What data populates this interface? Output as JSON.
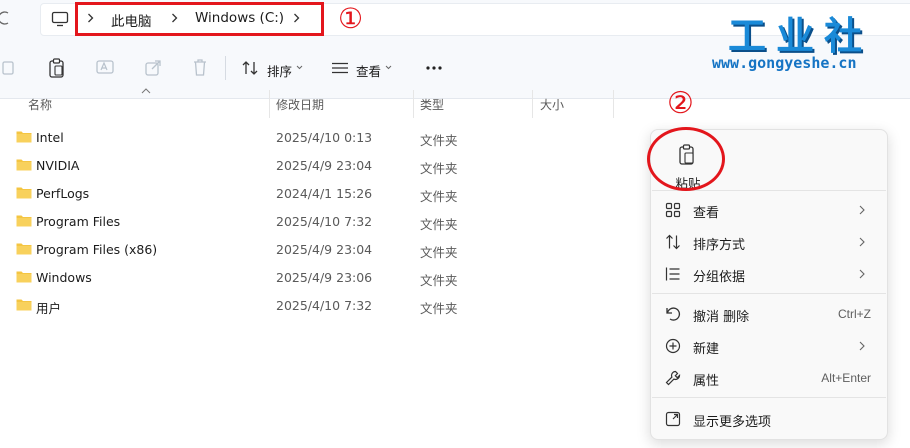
{
  "address_bar": {
    "crumbs": [
      "此电脑",
      "Windows (C:)"
    ]
  },
  "annotations": {
    "marker1": "①",
    "marker2": "②"
  },
  "toolbar": {
    "sort_label": "排序",
    "view_label": "查看"
  },
  "columns": {
    "name": "名称",
    "date": "修改日期",
    "type": "类型",
    "size": "大小"
  },
  "files": [
    {
      "name": "Intel",
      "date": "2025/4/10 0:13",
      "type": "文件夹"
    },
    {
      "name": "NVIDIA",
      "date": "2025/4/9 23:04",
      "type": "文件夹"
    },
    {
      "name": "PerfLogs",
      "date": "2024/4/1 15:26",
      "type": "文件夹"
    },
    {
      "name": "Program Files",
      "date": "2025/4/10 7:32",
      "type": "文件夹"
    },
    {
      "name": "Program Files (x86)",
      "date": "2025/4/9 23:04",
      "type": "文件夹"
    },
    {
      "name": "Windows",
      "date": "2025/4/9 23:06",
      "type": "文件夹"
    },
    {
      "name": "用户",
      "date": "2025/4/10 7:32",
      "type": "文件夹"
    }
  ],
  "watermark": {
    "title": "工业社",
    "url": "www.gongyeshe.cn"
  },
  "context_menu": {
    "paste_label": "粘贴",
    "items": [
      {
        "label": "查看",
        "icon": "grid-icon",
        "submenu": true,
        "shortcut": ""
      },
      {
        "label": "排序方式",
        "icon": "sort-icon",
        "submenu": true,
        "shortcut": ""
      },
      {
        "label": "分组依据",
        "icon": "group-icon",
        "submenu": true,
        "shortcut": ""
      },
      {
        "label": "撤消 删除",
        "icon": "undo-icon",
        "submenu": false,
        "shortcut": "Ctrl+Z"
      },
      {
        "label": "新建",
        "icon": "new-icon",
        "submenu": true,
        "shortcut": ""
      },
      {
        "label": "属性",
        "icon": "wrench-icon",
        "submenu": false,
        "shortcut": "Alt+Enter"
      },
      {
        "label": "显示更多选项",
        "icon": "more-options-icon",
        "submenu": false,
        "shortcut": ""
      }
    ]
  },
  "colors": {
    "annotation": "#e3161c",
    "folder": "#f4c542",
    "watermark": "#1a8ad8"
  }
}
